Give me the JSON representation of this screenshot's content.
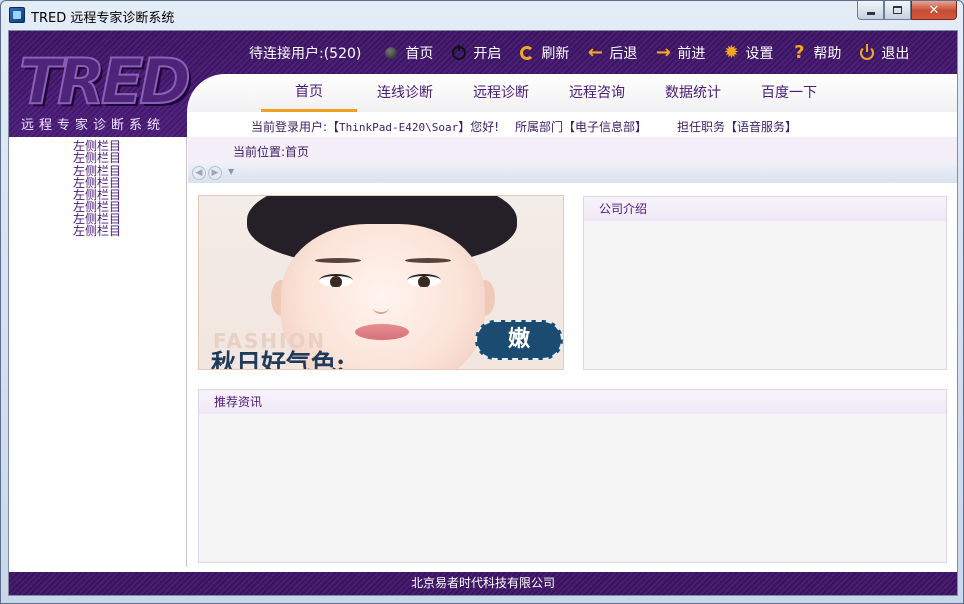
{
  "window": {
    "title": "TRED 远程专家诊断系统"
  },
  "header": {
    "logo_text": "TRED",
    "logo_subtitle": "远程专家诊断系统",
    "waiting_users_label": "待连接用户:(520)",
    "toolbar": [
      {
        "label": "首页",
        "icon": "home-icon"
      },
      {
        "label": "开启",
        "icon": "power-icon"
      },
      {
        "label": "刷新",
        "icon": "refresh-icon"
      },
      {
        "label": "后退",
        "icon": "back-arrow-icon"
      },
      {
        "label": "前进",
        "icon": "forward-arrow-icon"
      },
      {
        "label": "设置",
        "icon": "gear-icon"
      },
      {
        "label": "帮助",
        "icon": "help-icon"
      },
      {
        "label": "退出",
        "icon": "exit-icon"
      }
    ],
    "tabs": [
      {
        "label": "首页",
        "active": true
      },
      {
        "label": "连线诊断",
        "active": false
      },
      {
        "label": "远程诊断",
        "active": false
      },
      {
        "label": "远程咨询",
        "active": false
      },
      {
        "label": "数据统计",
        "active": false
      },
      {
        "label": "百度一下",
        "active": false
      }
    ],
    "user_info": {
      "current_user_prefix": "当前登录用户:【",
      "current_user": "ThinkPad-E420\\Soar",
      "current_user_suffix": "】您好!",
      "department": "所属部门【电子信息部】",
      "position": "担任职务【语音服务】"
    }
  },
  "sidebar": {
    "items": [
      "左侧栏目",
      "左侧栏目",
      "左侧栏目",
      "左侧栏目",
      "左侧栏目",
      "左侧栏目",
      "左侧栏目",
      "左侧栏目"
    ]
  },
  "main": {
    "breadcrumb": "当前位置:首页",
    "banner": {
      "fashion_text": "FASHION",
      "slogan": "秋日好气色:",
      "badge": "嫩"
    },
    "company_panel_title": "公司介绍",
    "news_panel_title": "推荐资讯"
  },
  "footer": {
    "text": "北京易者时代科技有限公司"
  },
  "colors": {
    "brand_purple": "#3d1366",
    "accent_orange": "#f3a81c",
    "text_purple": "#4a1a78"
  }
}
